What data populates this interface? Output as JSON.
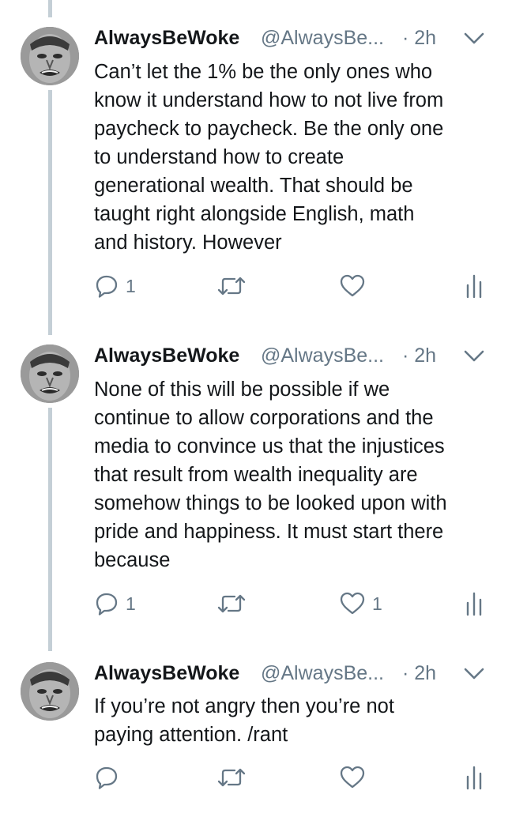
{
  "tweets": [
    {
      "name": "AlwaysBeWoke",
      "handle": "@AlwaysBe...",
      "time": "· 2h",
      "text": "Can’t let the 1% be the only ones who\nknow it understand how to not live from\npaycheck to paycheck. Be the only one\nto understand how to create\ngenerational wealth. That should be\ntaught right alongside English, math\nand history. However",
      "reply_count": "1",
      "retweet_count": "",
      "like_count": ""
    },
    {
      "name": "AlwaysBeWoke",
      "handle": "@AlwaysBe...",
      "time": "· 2h",
      "text": "None of this will be possible if we\ncontinue to allow corporations and the\nmedia to convince us that the injustices\nthat result from wealth inequality are\nsomehow things to be looked upon with\npride and happiness. It must start there\nbecause",
      "reply_count": "1",
      "retweet_count": "",
      "like_count": "1"
    },
    {
      "name": "AlwaysBeWoke",
      "handle": "@AlwaysBe...",
      "time": "· 2h",
      "text": "If you’re not angry then you’re not\npaying attention. /rant",
      "reply_count": "",
      "retweet_count": "",
      "like_count": ""
    }
  ],
  "icons": {
    "reply": "reply-icon",
    "retweet": "retweet-icon",
    "like": "heart-icon",
    "analytics": "analytics-icon",
    "more": "chevron-down-icon"
  },
  "colors": {
    "icon_gray": "#657786",
    "thread_line": "#c4cfd6",
    "text": "#14171a"
  }
}
